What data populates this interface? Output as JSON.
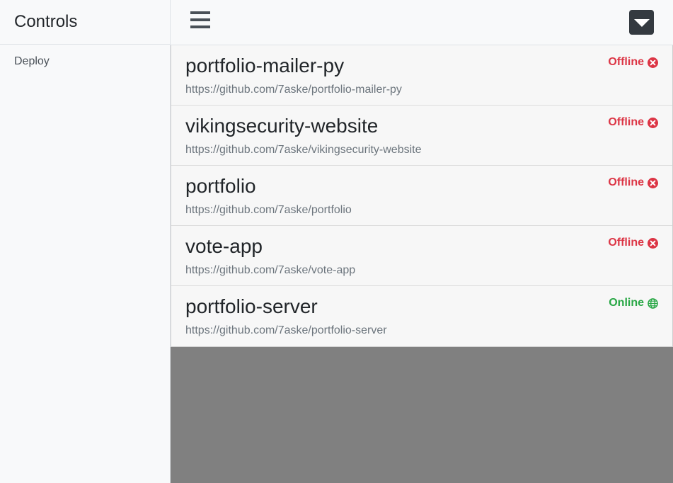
{
  "sidebar": {
    "title": "Controls",
    "items": [
      {
        "label": "Deploy"
      }
    ]
  },
  "topbar": {
    "menu_icon": "hamburger-icon",
    "dropdown_icon": "caret-down-icon"
  },
  "projects": [
    {
      "name": "portfolio-mailer-py",
      "url": "https://github.com/7aske/portfolio-mailer-py",
      "status": "Offline",
      "status_icon": "times-circle-icon",
      "color": "#dc3545"
    },
    {
      "name": "vikingsecurity-website",
      "url": "https://github.com/7aske/vikingsecurity-website",
      "status": "Offline",
      "status_icon": "times-circle-icon",
      "color": "#dc3545"
    },
    {
      "name": "portfolio",
      "url": "https://github.com/7aske/portfolio",
      "status": "Offline",
      "status_icon": "times-circle-icon",
      "color": "#dc3545"
    },
    {
      "name": "vote-app",
      "url": "https://github.com/7aske/vote-app",
      "status": "Offline",
      "status_icon": "times-circle-icon",
      "color": "#dc3545"
    },
    {
      "name": "portfolio-server",
      "url": "https://github.com/7aske/portfolio-server",
      "status": "Online",
      "status_icon": "globe-icon",
      "color": "#28a745"
    }
  ]
}
